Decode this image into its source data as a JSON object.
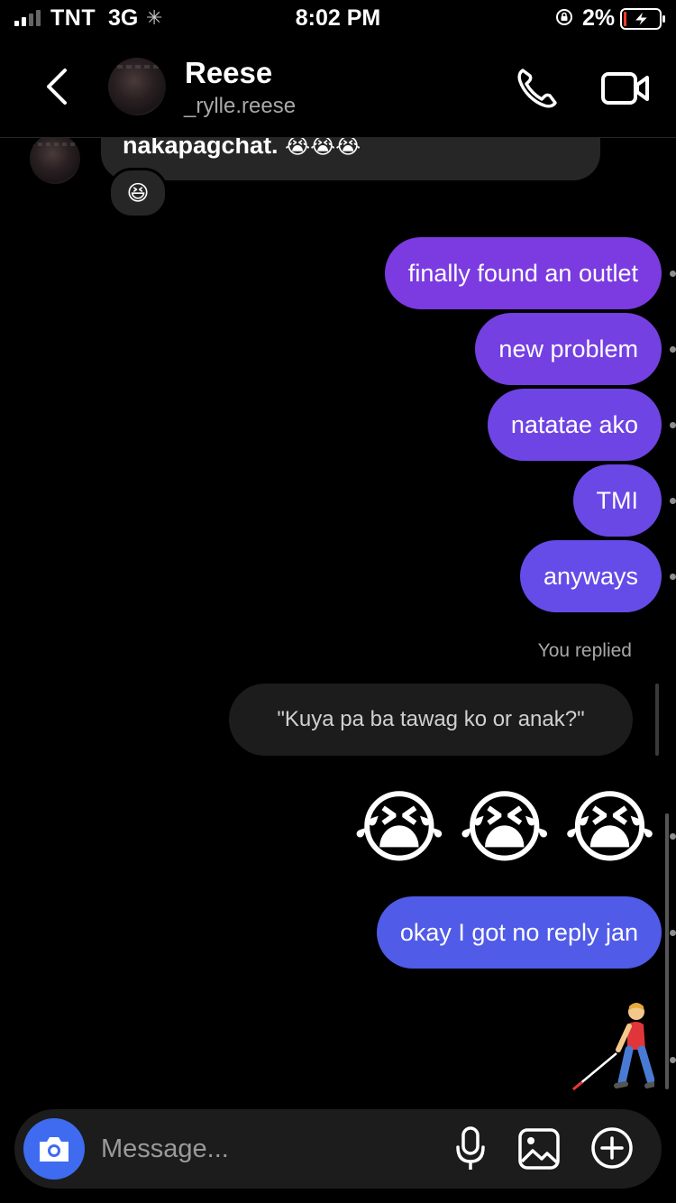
{
  "status_bar": {
    "carrier": "TNT",
    "network": "3G",
    "time": "8:02 PM",
    "battery": "2%"
  },
  "header": {
    "name": "Reese",
    "handle": "_rylle.reese",
    "icons": [
      "back-icon",
      "phone-icon",
      "video-icon"
    ]
  },
  "chat": {
    "incoming": {
      "text": "nakapagchat.",
      "emojis": "😭😭😭",
      "reaction": "😆"
    },
    "sent": [
      {
        "text": "finally found an outlet",
        "color": "#7b3be0"
      },
      {
        "text": "new problem",
        "color": "#7440e2"
      },
      {
        "text": "natatae ako",
        "color": "#6f44e4"
      },
      {
        "text": "TMI",
        "color": "#6a48e6"
      },
      {
        "text": "anyways",
        "color": "#654ce8"
      }
    ],
    "reply_label": "You replied",
    "reply_quote": "\"Kuya pa ba tawag ko or anak?\"",
    "big_emojis": [
      "😭",
      "😭",
      "😭"
    ],
    "last_message": {
      "text": "okay I got no reply jan",
      "color": "#505be8"
    },
    "sticker": "person-with-white-cane"
  },
  "composer": {
    "placeholder": "Message...",
    "icons": [
      "camera-icon",
      "microphone-icon",
      "gallery-icon",
      "add-icon"
    ],
    "camera_color": "#3e6bf0"
  }
}
